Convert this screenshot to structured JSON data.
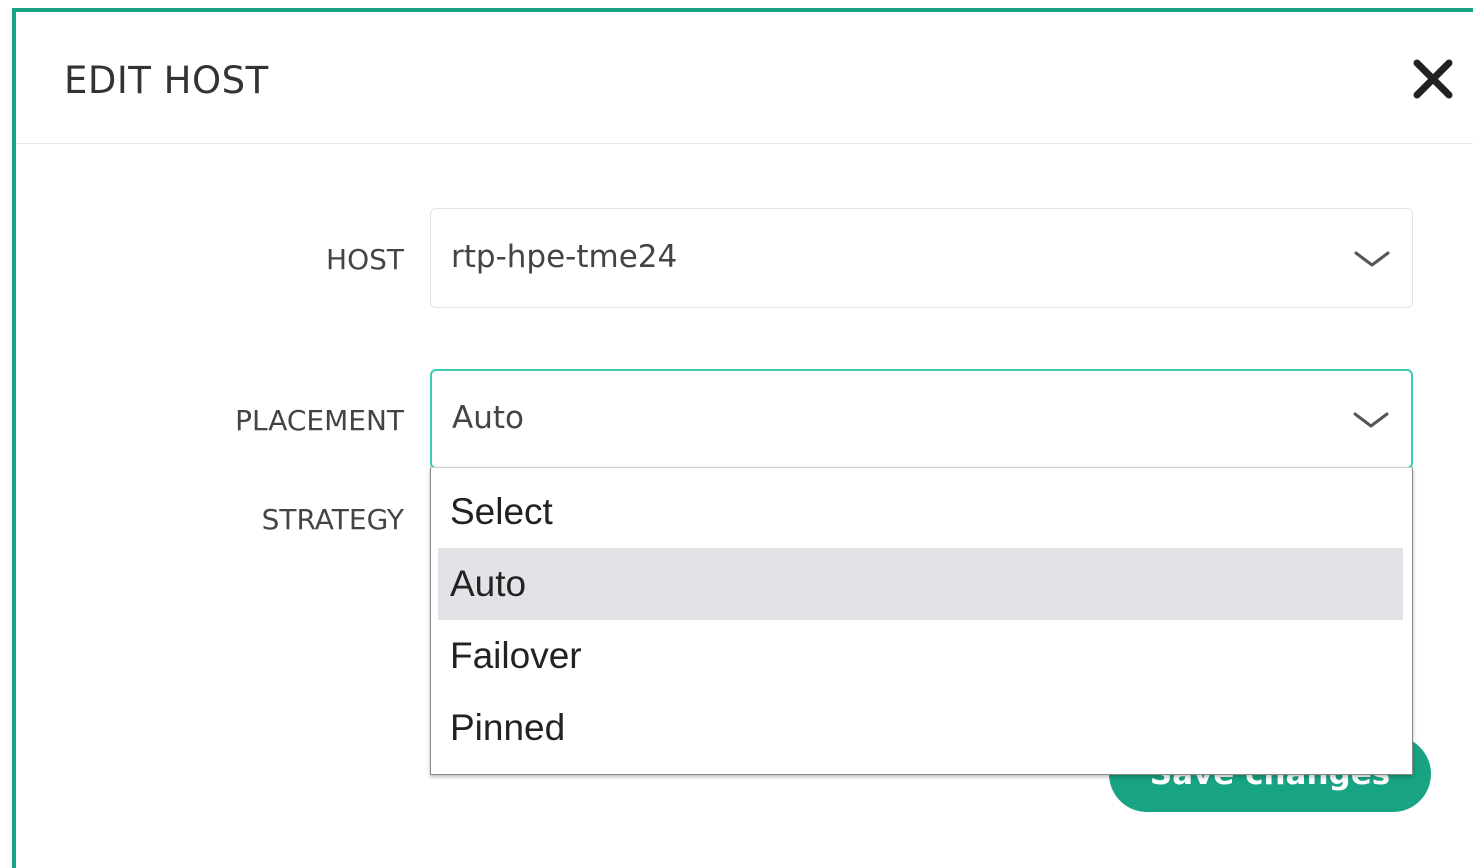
{
  "modal": {
    "title": "EDIT HOST",
    "close_icon": "close-icon"
  },
  "form": {
    "host": {
      "label": "HOST",
      "value": "rtp-hpe-tme24"
    },
    "placement": {
      "label": "PLACEMENT",
      "value": "Auto"
    },
    "strategy": {
      "label": "STRATEGY"
    }
  },
  "dropdown": {
    "options": [
      "Select",
      "Auto",
      "Failover",
      "Pinned"
    ],
    "highlighted": "Auto"
  },
  "footer": {
    "save_label": "Save changes"
  },
  "colors": {
    "accent": "#17a384",
    "focus_border": "#3cc9b6",
    "highlight": "#e2e2e7"
  }
}
